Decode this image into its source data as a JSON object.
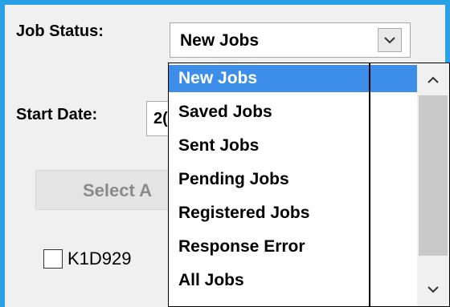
{
  "form": {
    "job_status_label": "Job Status:",
    "job_status_value": "New Jobs",
    "start_date_label": "Start Date:",
    "start_date_value_partial": "2(",
    "select_all_label_partial": "Select A",
    "checkbox_label_partial": "K1D929"
  },
  "dropdown": {
    "items": [
      {
        "label": "New Jobs",
        "selected": true
      },
      {
        "label": "Saved Jobs",
        "selected": false
      },
      {
        "label": "Sent Jobs",
        "selected": false
      },
      {
        "label": "Pending Jobs",
        "selected": false
      },
      {
        "label": "Registered Jobs",
        "selected": false
      },
      {
        "label": "Response Error",
        "selected": false
      },
      {
        "label": "All Jobs",
        "selected": false
      }
    ]
  },
  "icons": {
    "combo_arrow": "chevron-down-icon",
    "scroll_up": "chevron-up-icon",
    "scroll_down": "chevron-down-icon"
  },
  "colors": {
    "window_border": "#2aa0e6",
    "selection": "#3d8ee8"
  }
}
